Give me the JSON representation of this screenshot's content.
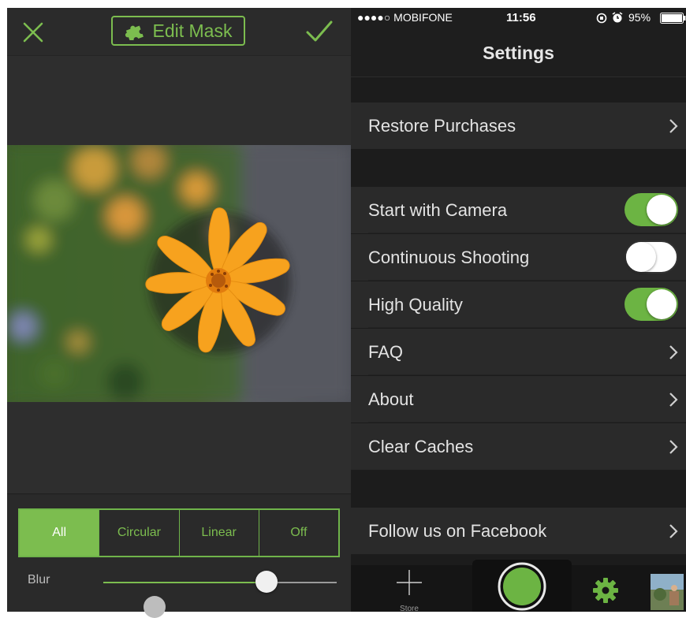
{
  "editor": {
    "title": "Edit Mask",
    "segments": [
      "All",
      "Circular",
      "Linear",
      "Off"
    ],
    "active_segment": "All",
    "blur_label": "Blur",
    "blur_value": 0.7,
    "accent": "#7cbd4f"
  },
  "status_bar": {
    "carrier": "●●●●○ MOBIFONE",
    "time": "11:56",
    "battery": "95%"
  },
  "settings": {
    "title": "Settings",
    "restore": "Restore Purchases",
    "start_camera": "Start with Camera",
    "start_camera_on": true,
    "continuous": "Continuous Shooting",
    "continuous_on": false,
    "high_quality": "High Quality",
    "high_quality_on": true,
    "faq": "FAQ",
    "about": "About",
    "clear": "Clear Caches",
    "facebook": "Follow us on Facebook"
  },
  "tab_bar": {
    "store": "Store",
    "toggle_color": "#6cb443"
  }
}
